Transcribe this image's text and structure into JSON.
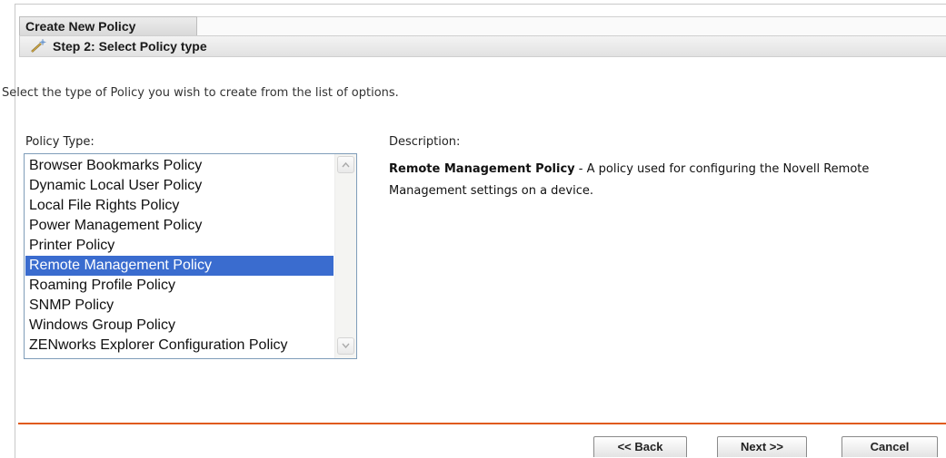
{
  "header": {
    "title": "Create New Policy",
    "step_label": "Step 2: Select Policy type",
    "step_icon": "wand-icon"
  },
  "intro": "Select the type of Policy you wish to create from the list of options.",
  "policy_type": {
    "label": "Policy Type:",
    "items": [
      "Browser Bookmarks Policy",
      "Dynamic Local User Policy",
      "Local File Rights Policy",
      "Power Management Policy",
      "Printer Policy",
      "Remote Management Policy",
      "Roaming Profile Policy",
      "SNMP Policy",
      "Windows Group Policy",
      "ZENworks Explorer Configuration Policy"
    ],
    "selected_index": 5
  },
  "description": {
    "label": "Description:",
    "name": "Remote Management Policy",
    "text": " - A policy used for configuring the Novell Remote Management settings on a device."
  },
  "buttons": {
    "back": "<< Back",
    "next": "Next >>",
    "cancel": "Cancel"
  },
  "colors": {
    "accent": "#e05a1b",
    "selection": "#3a6ccf"
  }
}
